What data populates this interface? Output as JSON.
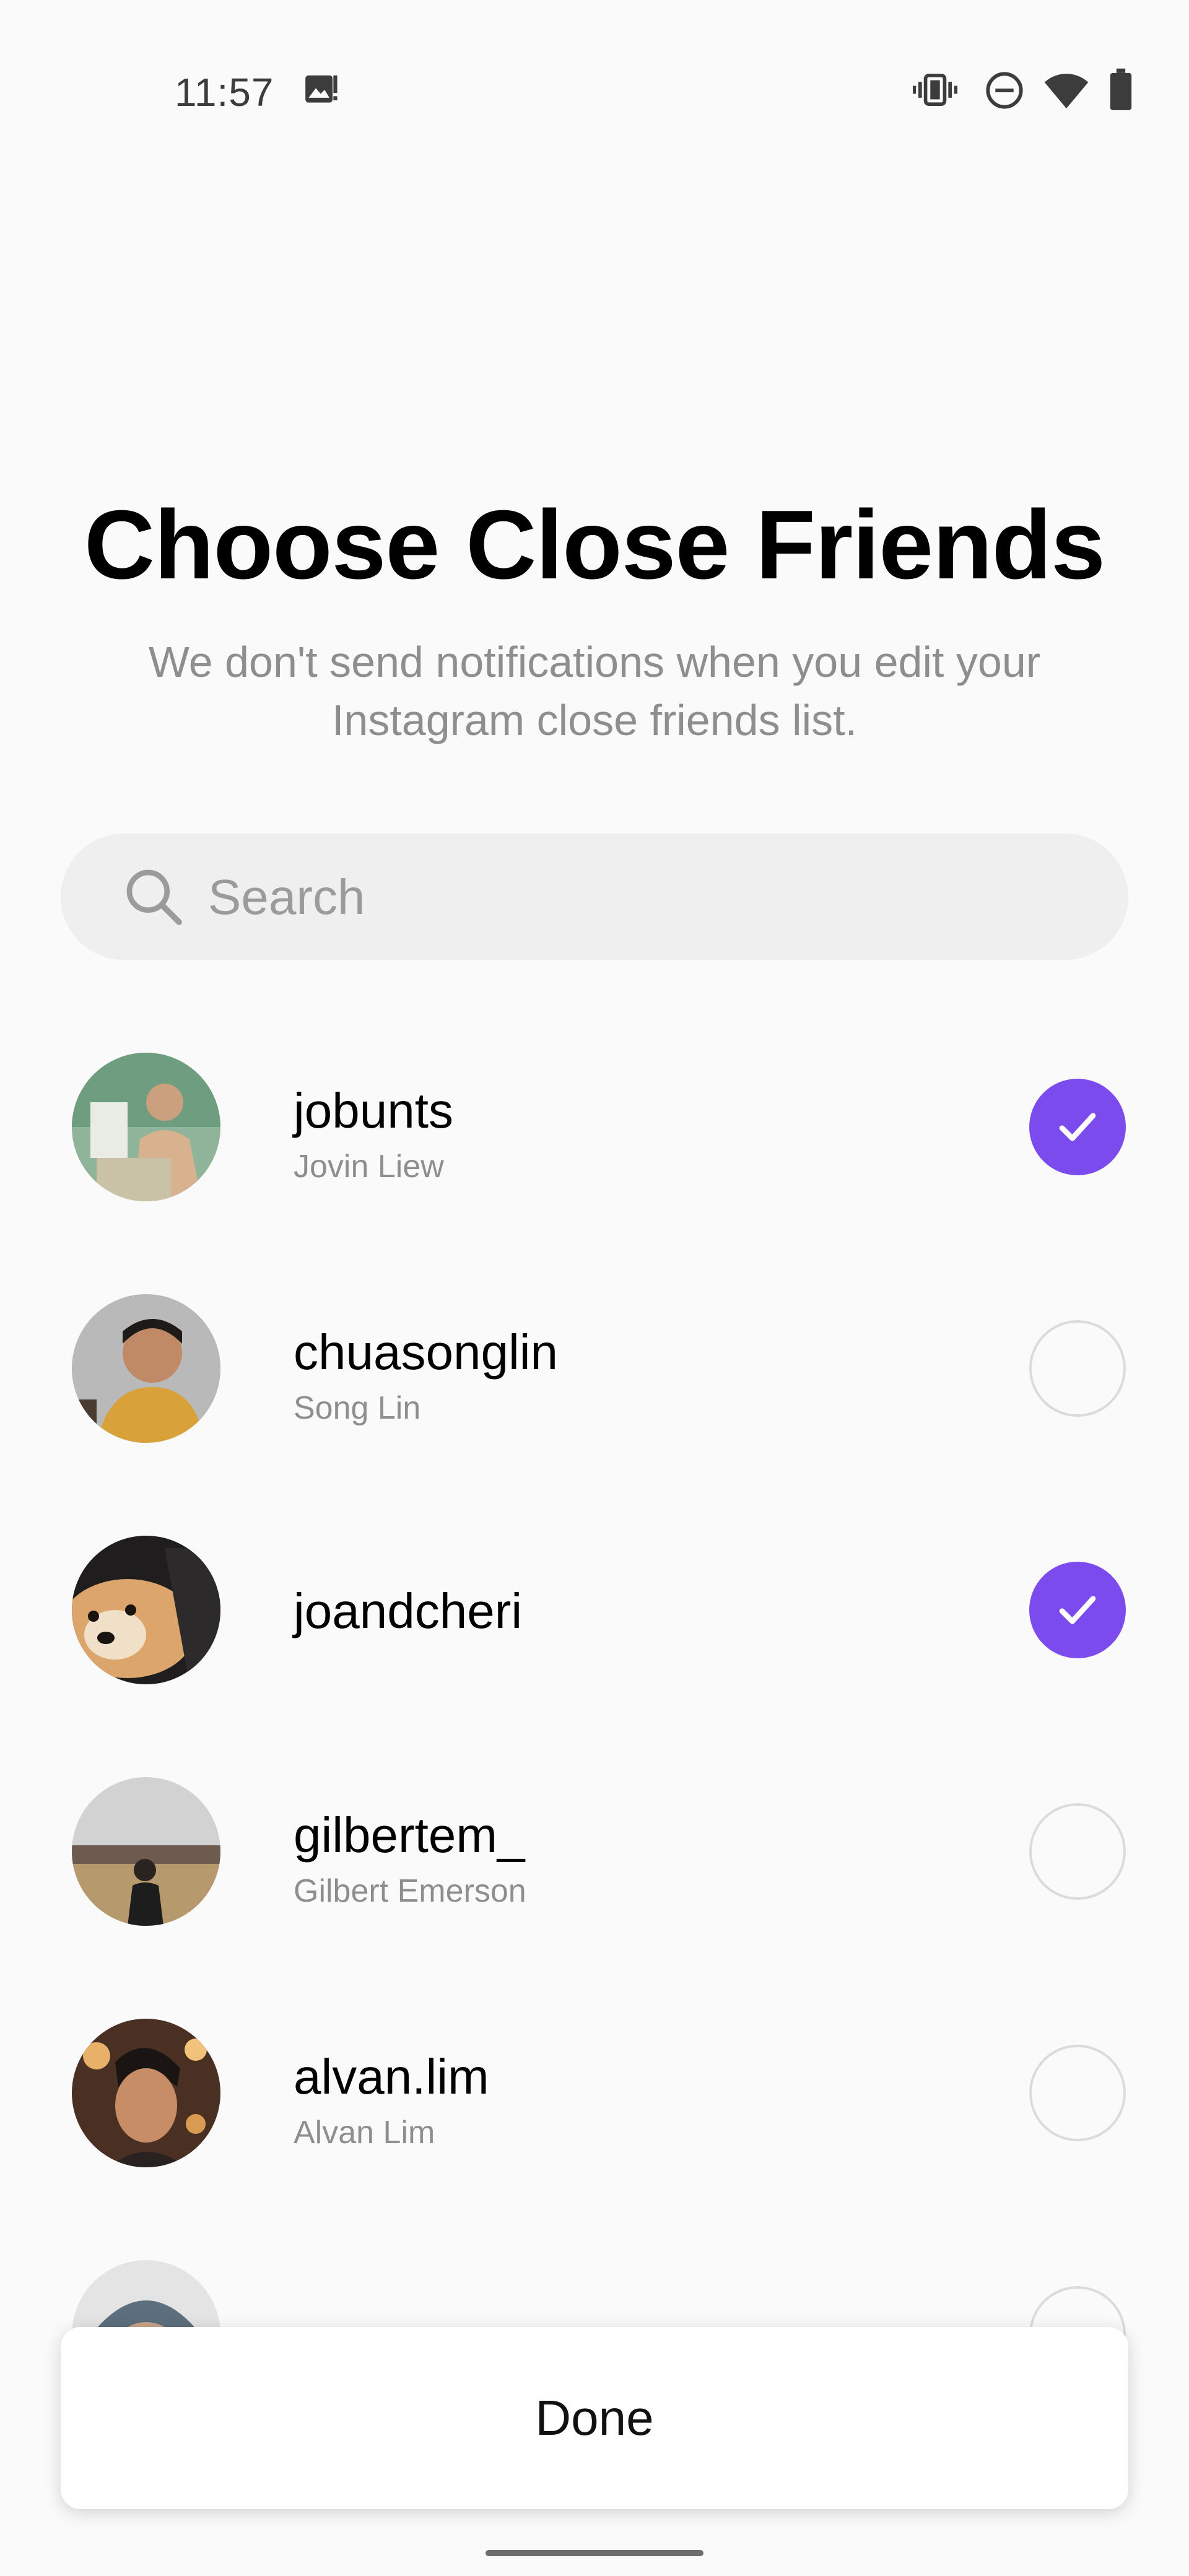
{
  "status_bar": {
    "time": "11:57",
    "left_icons": [
      "image-notification-icon"
    ],
    "right_icons": [
      "vibrate-icon",
      "do-not-disturb-icon",
      "wifi-icon",
      "battery-icon"
    ]
  },
  "header": {
    "title": "Choose Close Friends",
    "subtitle_line1": "We don't send notifications when you edit your",
    "subtitle_line2": "Instagram close friends list."
  },
  "search": {
    "placeholder": "Search",
    "value": ""
  },
  "friends": [
    {
      "username": "jobunts",
      "full_name": "Jovin Liew",
      "selected": true
    },
    {
      "username": "chuasonglin",
      "full_name": "Song Lin",
      "selected": false
    },
    {
      "username": "joandcheri",
      "full_name": "",
      "selected": true
    },
    {
      "username": "gilbertem_",
      "full_name": "Gilbert Emerson",
      "selected": false
    },
    {
      "username": "alvan.lim",
      "full_name": "Alvan Lim",
      "selected": false
    },
    {
      "username": "",
      "full_name": "",
      "selected": false
    }
  ],
  "colors": {
    "accent": "#7b4bed",
    "unselected_border": "#dbdbdb",
    "secondary_text": "#8e8e8e",
    "search_bg": "#efefef"
  },
  "done_button": {
    "label": "Done"
  }
}
